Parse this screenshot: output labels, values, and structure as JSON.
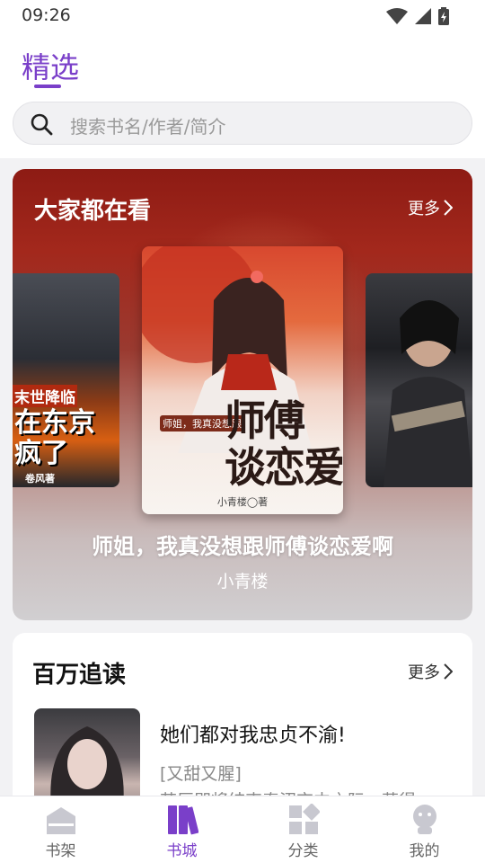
{
  "status_bar": {
    "time": "09:26"
  },
  "header": {
    "title": "精选"
  },
  "search": {
    "placeholder": "搜索书名/作者/简介"
  },
  "hot_section": {
    "title": "大家都在看",
    "more": "更多",
    "covers": {
      "left": {
        "tag": "末世降临",
        "title": "在东京\n疯了",
        "author": "卷风著"
      },
      "center": {
        "small_title": "师姐，我真没想跟",
        "title": "师傅\n谈恋爱",
        "author": "小青楼◯著"
      }
    },
    "featured_title": "师姐，我真没想跟师傅谈恋爱啊",
    "featured_author": "小青楼"
  },
  "million_section": {
    "title": "百万追读",
    "more": "更多",
    "item": {
      "title": "她们都对我忠贞不渝!",
      "tags": "[又甜又腥]",
      "desc": "苏辰即将结束秦沼京中之际，获得"
    }
  },
  "tabbar": {
    "tabs": [
      {
        "label": "书架"
      },
      {
        "label": "书城"
      },
      {
        "label": "分类"
      },
      {
        "label": "我的"
      }
    ],
    "active_index": 1
  },
  "colors": {
    "accent": "#7a3fc9"
  }
}
